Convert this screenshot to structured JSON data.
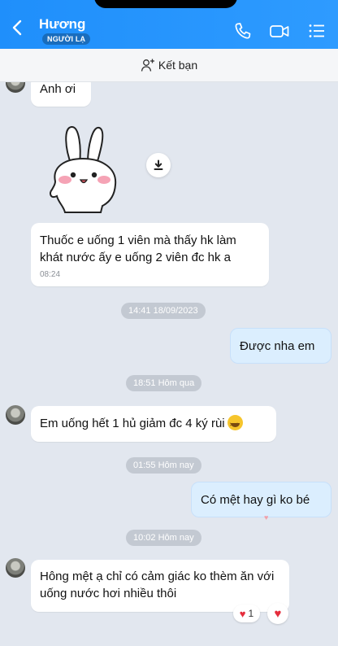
{
  "header": {
    "contact_name": "Hương",
    "badge": "NGƯỜI LẠ",
    "icons": [
      "back-arrow-icon",
      "phone-icon",
      "video-call-icon",
      "menu-list-icon"
    ]
  },
  "friend_bar": {
    "label": "Kết bạn",
    "icon": "add-person-icon"
  },
  "messages": {
    "m1": {
      "text": "Anh ơi"
    },
    "m2": {
      "text": "Thuốc e uống 1 viên mà thấy hk làm khát nước ấy e uống 2 viên đc hk a",
      "time": "08:24"
    },
    "d1": "14:41 18/09/2023",
    "m3": {
      "text": "Được nha em"
    },
    "d2": "18:51 Hôm qua",
    "m4": {
      "text": "Em uống hết 1 hủ giảm đc 4 ký rùi"
    },
    "d3": "01:55 Hôm nay",
    "m5": {
      "text": "Có mệt hay gì ko bé"
    },
    "d4": "10:02 Hôm nay",
    "m6": {
      "text": "Hông mệt ạ chỉ có cảm giác ko thèm ăn với uống nước hơi nhiều thôi",
      "reaction_count": "1"
    }
  },
  "colors": {
    "header": "#2496fd",
    "chat_bg": "#e2e7ef",
    "outgoing": "#dbeefe",
    "heart": "#e52d3c"
  }
}
